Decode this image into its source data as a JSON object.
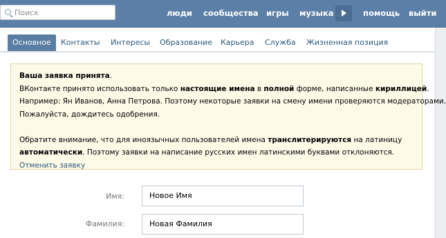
{
  "header": {
    "search": {
      "placeholder": "Поиск",
      "value": ""
    },
    "nav": {
      "people": "люди",
      "communities": "сообщества",
      "games": "игры",
      "music": "музыка",
      "help": "помощь",
      "logout": "выйти"
    }
  },
  "tabs": [
    {
      "label": "Основное",
      "active": true
    },
    {
      "label": "Контакты"
    },
    {
      "label": "Интересы"
    },
    {
      "label": "Образование"
    },
    {
      "label": "Карьера"
    },
    {
      "label": "Служба"
    },
    {
      "label": "Жизненная позиция"
    }
  ],
  "notice": {
    "title": "Ваша заявка принята",
    "l1_a": "ВКонтакте принято использовать только ",
    "l1_b": "настоящие имена",
    "l1_c": " в ",
    "l1_d": "полной",
    "l1_e": " форме, написанные ",
    "l1_f": "кириллицей",
    "l2": "Например: Ян Иванов, Анна Петрова. Поэтому некоторые заявки на смену имени проверяются модераторами.",
    "l3": "Пожалуйста, дождитесь одобрения.",
    "l4_a": "Обратите внимание, что для иноязычных пользователей имена ",
    "l4_b": "транслитерируются",
    "l4_c": " на латиницу",
    "l5_a": "автоматически",
    "l5_b": ". Поэтому заявки на написание русских имен латинскими буквами отклоняются.",
    "cancel": "Отменить заявку"
  },
  "form": {
    "first_name_label": "Имя:",
    "first_name_value": "Новое Имя",
    "last_name_label": "Фамилия:",
    "last_name_value": "Новая Фамилия"
  },
  "colors": {
    "header_bg": "#5b7fa6",
    "active_tab": "#597da3",
    "link": "#2b587a",
    "notice_bg": "#fefae8",
    "notice_border": "#e2d59f"
  }
}
